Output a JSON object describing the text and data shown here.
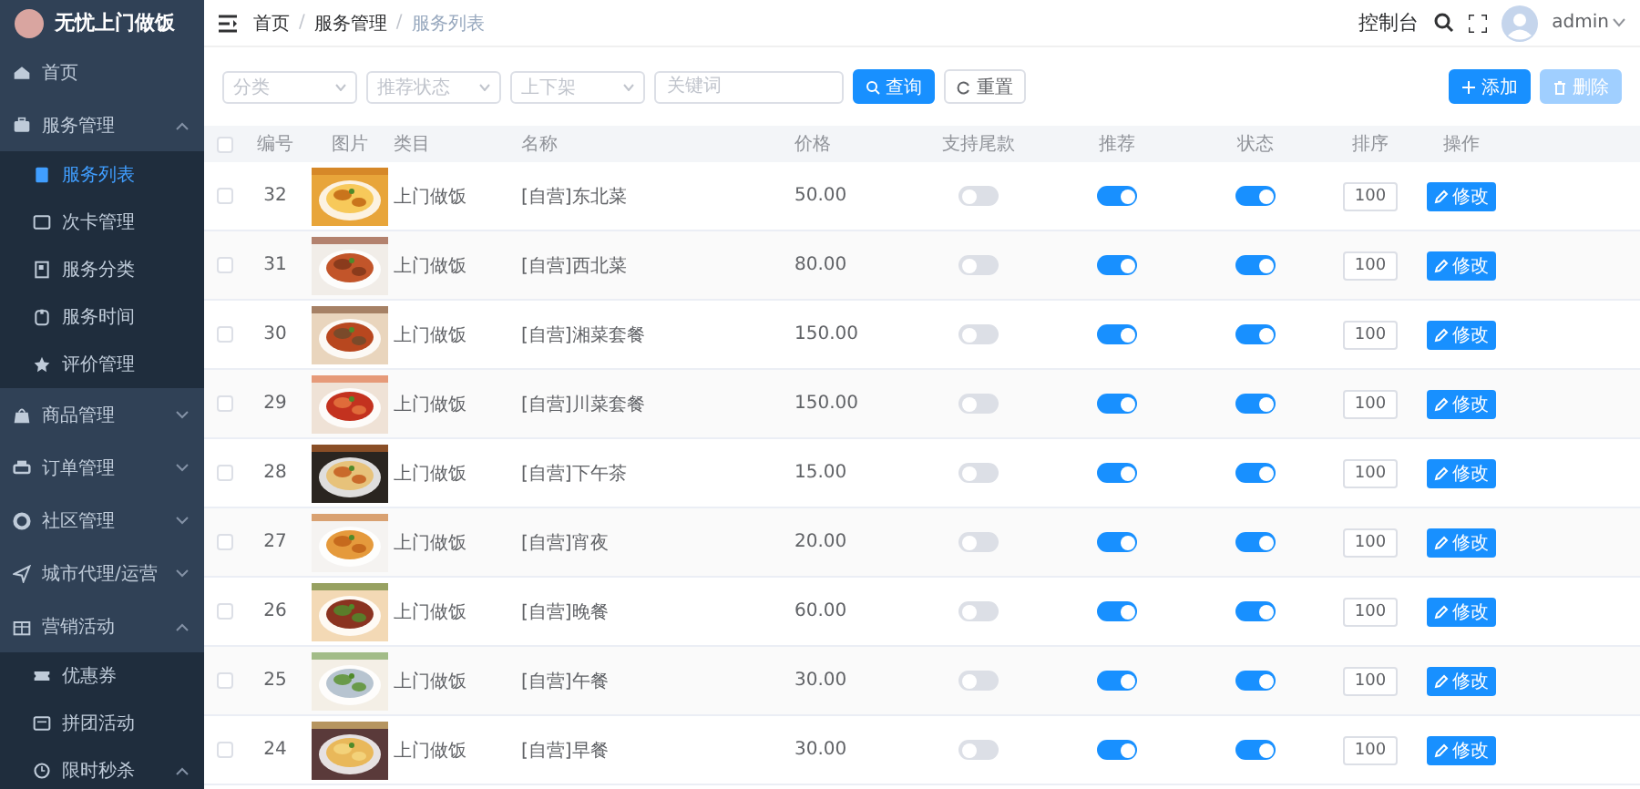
{
  "sidebar": {
    "title": "无忧上门做饭",
    "items": [
      {
        "label": "首页",
        "selected": false
      },
      {
        "label": "服务管理",
        "selected": false,
        "expanded": true,
        "children": [
          {
            "label": "服务列表",
            "selected": true
          },
          {
            "label": "次卡管理",
            "selected": false
          },
          {
            "label": "服务分类",
            "selected": false
          },
          {
            "label": "服务时间",
            "selected": false
          },
          {
            "label": "评价管理",
            "selected": false
          }
        ]
      },
      {
        "label": "商品管理",
        "selected": false,
        "expanded": false
      },
      {
        "label": "订单管理",
        "selected": false,
        "expanded": false
      },
      {
        "label": "社区管理",
        "selected": false,
        "expanded": false
      },
      {
        "label": "城市代理/运营",
        "selected": false,
        "expanded": false
      },
      {
        "label": "营销活动",
        "selected": false,
        "expanded": true,
        "children": [
          {
            "label": "优惠券",
            "selected": false
          },
          {
            "label": "拼团活动",
            "selected": false
          },
          {
            "label": "限时秒杀",
            "selected": false,
            "expanded": true
          }
        ]
      }
    ]
  },
  "header": {
    "breadcrumb": [
      "首页",
      "服务管理",
      "服务列表"
    ],
    "separators": [
      "/",
      "/"
    ],
    "console": "控制台",
    "user": "admin"
  },
  "filters": {
    "selects": [
      {
        "placeholder": "分类"
      },
      {
        "placeholder": "推荐状态"
      },
      {
        "placeholder": "上下架"
      }
    ],
    "keyword": {
      "placeholder": "关键词"
    },
    "search_button": "查询",
    "reset_button": "重置",
    "add_button": "添加",
    "delete_button": {
      "label": "删除",
      "disabled": true
    }
  },
  "table": {
    "select_all": {
      "checked": false
    },
    "columns": [
      "编号",
      "图片",
      "类目",
      "名称",
      "价格",
      "支持尾款",
      "推荐",
      "状态",
      "排序",
      "操作"
    ],
    "rows": [
      {
        "checked": false,
        "id": "32",
        "category": "上门做饭",
        "name": "[自营]东北菜",
        "price": "50.00",
        "deposit": false,
        "recommended": true,
        "status": true,
        "sort": "100",
        "action": "修改"
      },
      {
        "checked": false,
        "id": "31",
        "category": "上门做饭",
        "name": "[自营]西北菜",
        "price": "80.00",
        "deposit": false,
        "recommended": true,
        "status": true,
        "sort": "100",
        "action": "修改"
      },
      {
        "checked": false,
        "id": "30",
        "category": "上门做饭",
        "name": "[自营]湘菜套餐",
        "price": "150.00",
        "deposit": false,
        "recommended": true,
        "status": true,
        "sort": "100",
        "action": "修改"
      },
      {
        "checked": false,
        "id": "29",
        "category": "上门做饭",
        "name": "[自营]川菜套餐",
        "price": "150.00",
        "deposit": false,
        "recommended": true,
        "status": true,
        "sort": "100",
        "action": "修改"
      },
      {
        "checked": false,
        "id": "28",
        "category": "上门做饭",
        "name": "[自营]下午茶",
        "price": "15.00",
        "deposit": false,
        "recommended": true,
        "status": true,
        "sort": "100",
        "action": "修改"
      },
      {
        "checked": false,
        "id": "27",
        "category": "上门做饭",
        "name": "[自营]宵夜",
        "price": "20.00",
        "deposit": false,
        "recommended": true,
        "status": true,
        "sort": "100",
        "action": "修改"
      },
      {
        "checked": false,
        "id": "26",
        "category": "上门做饭",
        "name": "[自营]晚餐",
        "price": "60.00",
        "deposit": false,
        "recommended": true,
        "status": true,
        "sort": "100",
        "action": "修改"
      },
      {
        "checked": false,
        "id": "25",
        "category": "上门做饭",
        "name": "[自营]午餐",
        "price": "30.00",
        "deposit": false,
        "recommended": true,
        "status": true,
        "sort": "100",
        "action": "修改"
      },
      {
        "checked": false,
        "id": "24",
        "category": "上门做饭",
        "name": "[自营]早餐",
        "price": "30.00",
        "deposit": false,
        "recommended": true,
        "status": true,
        "sort": "100",
        "action": "修改"
      }
    ]
  }
}
